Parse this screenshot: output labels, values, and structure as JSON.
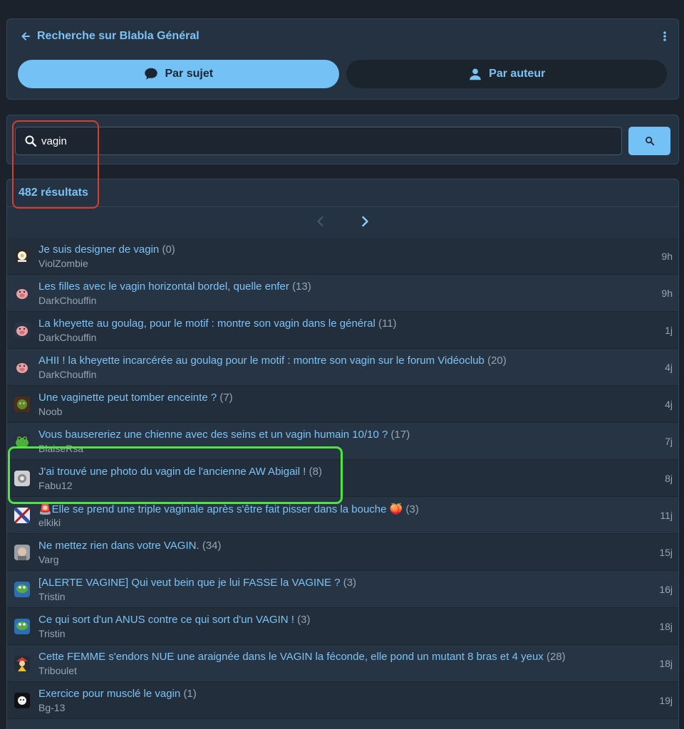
{
  "header": {
    "title": "Recherche sur Blabla Général",
    "tabs": [
      {
        "label": "Par sujet",
        "active": true,
        "icon": "chat-bubble-icon"
      },
      {
        "label": "Par auteur",
        "active": false,
        "icon": "person-icon"
      }
    ]
  },
  "search": {
    "value": "vagin"
  },
  "results": {
    "count_label": "482 résultats",
    "items": [
      {
        "title": "Je suis designer de vagin",
        "count": "(0)",
        "author": "ViolZombie",
        "time": "9h",
        "avatar": "egg-avatar"
      },
      {
        "title": "Les filles avec le vagin horizontal bordel, quelle enfer",
        "count": "(13)",
        "author": "DarkChouffin",
        "time": "9h",
        "avatar": "pig-avatar"
      },
      {
        "title": "La kheyette au goulag, pour le motif : montre son vagin dans le général",
        "count": "(11)",
        "author": "DarkChouffin",
        "time": "1j",
        "avatar": "pig-avatar"
      },
      {
        "title": "AHII ! la kheyette incarcérée au goulag pour le motif : montre son vagin sur le forum Vidéoclub",
        "count": "(20)",
        "author": "DarkChouffin",
        "time": "4j",
        "avatar": "pig-avatar"
      },
      {
        "title": "Une vaginette peut tomber enceinte ?",
        "count": "(7)",
        "author": "Noob",
        "time": "4j",
        "avatar": "goblin-avatar"
      },
      {
        "title": "Vous bausereriez une chienne avec des seins et un vagin humain 10/10 ?",
        "count": "(17)",
        "author": "BlaiseRsa",
        "time": "7j",
        "avatar": "frog-avatar"
      },
      {
        "title": "J'ai trouvé une photo du vagin de l'ancienne AW Abigail !",
        "count": "(8)",
        "author": "Fabu12",
        "time": "8j",
        "avatar": "grey-avatar"
      },
      {
        "title": "🚨Elle se prend une triple vaginale après s'être fait pisser dans la bouche 🍑",
        "count": "(3)",
        "author": "elkiki",
        "time": "11j",
        "avatar": "flag-avatar"
      },
      {
        "title": "Ne mettez rien dans votre VAGIN.",
        "count": "(34)",
        "author": "Varg",
        "time": "15j",
        "avatar": "face-avatar"
      },
      {
        "title": "[ALERTE VAGINE] Qui veut bein que je lui FASSE la VAGINE ?",
        "count": "(3)",
        "author": "Tristin",
        "time": "16j",
        "avatar": "pepe-avatar"
      },
      {
        "title": "Ce qui sort d'un ANUS contre ce qui sort d'un VAGIN !",
        "count": "(3)",
        "author": "Tristin",
        "time": "18j",
        "avatar": "pepe-avatar"
      },
      {
        "title": "Cette FEMME s'endors NUE une araignée dans le VAGIN la féconde, elle pond un mutant 8 bras et 4 yeux",
        "count": "(28)",
        "author": "Triboulet",
        "time": "18j",
        "avatar": "jester-avatar"
      },
      {
        "title": "Exercice pour musclé le vagin",
        "count": "(1)",
        "author": "Bg-13",
        "time": "19j",
        "avatar": "ghost-avatar"
      }
    ]
  },
  "colors": {
    "accent": "#74c1f6",
    "link": "#7cc3f5",
    "highlight_red": "#e03a2a",
    "highlight_green": "#4de63a"
  }
}
